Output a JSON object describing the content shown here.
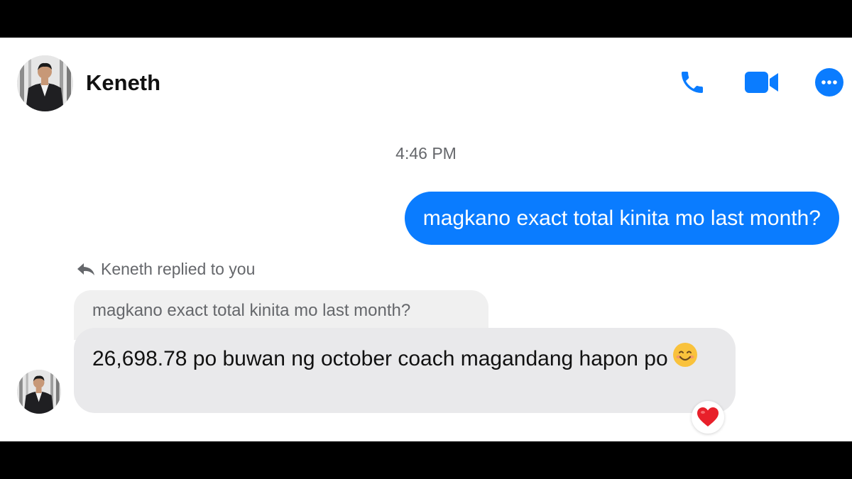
{
  "contact": {
    "name": "Keneth",
    "avatar_icon": "profile-photo"
  },
  "header_actions": {
    "call_icon": "phone-icon",
    "video_icon": "video-camera-icon",
    "more_icon": "more-options-icon"
  },
  "conversation": {
    "timestamp": "4:46 PM",
    "outgoing_message": "magkano exact total kinita mo last month?",
    "reply_context": {
      "label": "Keneth replied to you",
      "quoted_text": "magkano exact total kinita mo last month?"
    },
    "incoming_message": "26,698.78 po buwan ng october coach magandang hapon po",
    "incoming_emoji": "smiling-face-emoji",
    "reaction": "heart"
  },
  "colors": {
    "accent": "#0a7cff",
    "incoming_bubble": "#e9e9eb",
    "quote_bubble": "#f0f0f0",
    "secondary_text": "#65676b",
    "reaction": "#e8202a"
  }
}
